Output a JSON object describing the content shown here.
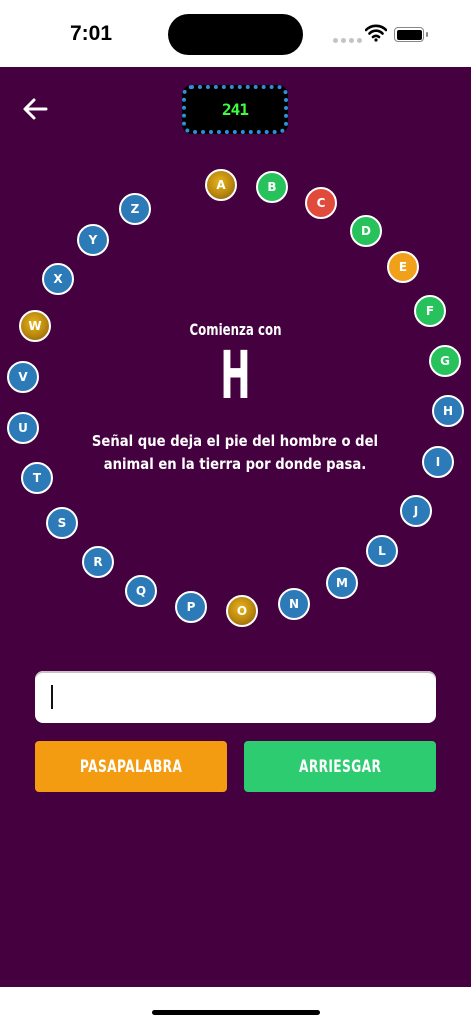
{
  "status_bar": {
    "time": "7:01"
  },
  "header": {
    "back_icon": "arrow-left-icon",
    "timer": "241"
  },
  "colors": {
    "background": "#45013f",
    "pending": "#2c7bb8",
    "correct": "#27c25c",
    "wrong": "#e04b3b",
    "passed": "#f1a01a",
    "current": "#c8950f",
    "timer_text": "#3dff3d",
    "pass_button": "#f39c12",
    "risk_button": "#2ecc71"
  },
  "rosco": [
    {
      "letter": "A",
      "status": "current"
    },
    {
      "letter": "B",
      "status": "correct"
    },
    {
      "letter": "C",
      "status": "wrong"
    },
    {
      "letter": "D",
      "status": "correct"
    },
    {
      "letter": "E",
      "status": "passed"
    },
    {
      "letter": "F",
      "status": "correct"
    },
    {
      "letter": "G",
      "status": "correct"
    },
    {
      "letter": "H",
      "status": "pending"
    },
    {
      "letter": "I",
      "status": "pending"
    },
    {
      "letter": "J",
      "status": "pending"
    },
    {
      "letter": "L",
      "status": "pending"
    },
    {
      "letter": "M",
      "status": "pending"
    },
    {
      "letter": "N",
      "status": "pending"
    },
    {
      "letter": "O",
      "status": "current"
    },
    {
      "letter": "P",
      "status": "pending"
    },
    {
      "letter": "Q",
      "status": "pending"
    },
    {
      "letter": "R",
      "status": "pending"
    },
    {
      "letter": "S",
      "status": "pending"
    },
    {
      "letter": "T",
      "status": "pending"
    },
    {
      "letter": "U",
      "status": "pending"
    },
    {
      "letter": "V",
      "status": "pending"
    },
    {
      "letter": "W",
      "status": "current"
    },
    {
      "letter": "X",
      "status": "pending"
    },
    {
      "letter": "Y",
      "status": "pending"
    },
    {
      "letter": "Z",
      "status": "pending"
    }
  ],
  "question": {
    "label": "Comienza con",
    "letter": "H",
    "clue": "Señal que deja el pie del hombre o del animal en la tierra por donde pasa."
  },
  "answer": {
    "value": "",
    "placeholder": ""
  },
  "actions": {
    "pass_label": "PASAPALABRA",
    "risk_label": "ARRIESGAR"
  }
}
